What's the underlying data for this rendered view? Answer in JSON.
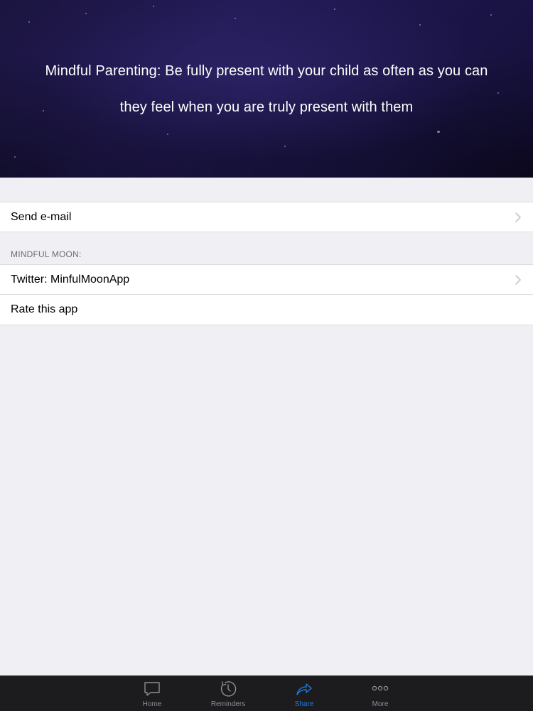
{
  "banner": {
    "quote_line_1": "Mindful Parenting: Be fully present with your child as often as you can",
    "quote_line_2": "they feel when you are truly present with them"
  },
  "list": {
    "send_email_label": "Send e-mail",
    "section_header": "MINDFUL MOON:",
    "twitter_label": "Twitter: MinfulMoonApp",
    "rate_label": "Rate this app"
  },
  "tabbar": {
    "tabs": [
      {
        "label": "Home",
        "icon": "chat-bubble-icon"
      },
      {
        "label": "Reminders",
        "icon": "clock-icon"
      },
      {
        "label": "Share",
        "icon": "share-arrow-icon"
      },
      {
        "label": "More",
        "icon": "more-dots-icon"
      }
    ],
    "active_tab": "Share",
    "active_color": "#1f7ae0",
    "inactive_color": "#8e8e93"
  }
}
